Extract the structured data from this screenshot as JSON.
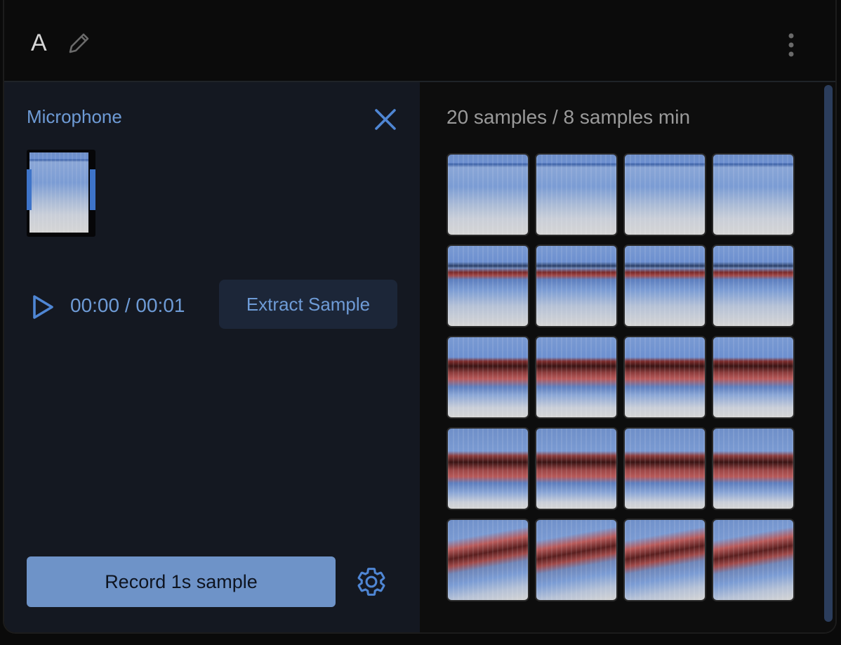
{
  "header": {
    "class_name": "A",
    "icons": {
      "edit": "pencil-icon",
      "more": "more-vert-icon"
    }
  },
  "recorder": {
    "source_label": "Microphone",
    "close_icon": "close-icon",
    "time_display": "00:00 / 00:01",
    "extract_label": "Extract Sample",
    "record_label": "Record 1s sample",
    "settings_icon": "gear-icon"
  },
  "samples": {
    "count_text": "20 samples / 8 samples min",
    "total": 20
  },
  "colors": {
    "accent": "#6e9bd6",
    "record_button": "#6e93c8",
    "panel_left": "#141821",
    "panel_right": "#0d0d0d"
  }
}
